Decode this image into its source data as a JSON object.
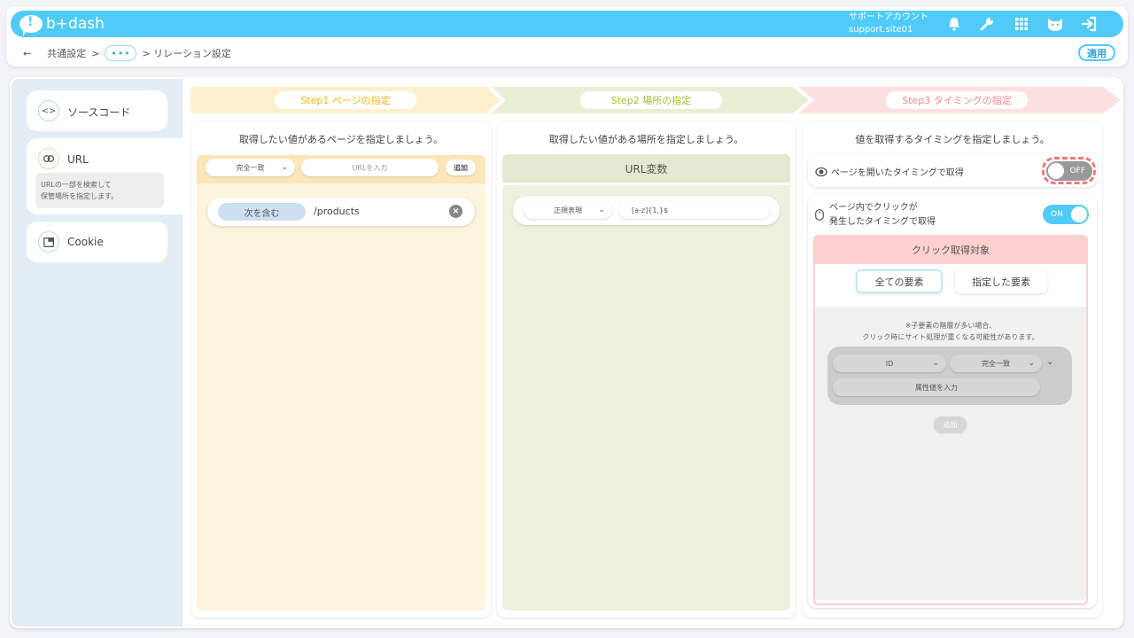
{
  "header": {
    "logo_text": "b+dash",
    "account_line1": "サポートアカウント",
    "account_line2": "support.site01",
    "icons": [
      "bell-icon",
      "wrench-icon",
      "grid-icon",
      "cat-face-icon",
      "logout-icon"
    ]
  },
  "breadcrumb": {
    "back": "←",
    "common": "共通設定",
    "sep": ">",
    "more": "•••",
    "current": "> リレーション設定"
  },
  "apply_label": "適用",
  "sidebar": {
    "items": [
      {
        "label": "ソースコード",
        "icon": "code-icon"
      },
      {
        "label": "URL",
        "icon": "link-icon",
        "desc1": "URLの一部を検索して",
        "desc2": "保管場所を指定します。"
      },
      {
        "label": "Cookie",
        "icon": "window-icon"
      }
    ]
  },
  "steps": [
    {
      "label": "Step1 ページの指定",
      "color": "#f5b70f"
    },
    {
      "label": "Step2 場所の指定",
      "color": "#9dc234"
    },
    {
      "label": "Step3 タイミングの指定",
      "color": "#f28a8a"
    }
  ],
  "step1": {
    "title": "取得したい値があるページを指定しましょう。",
    "match_select": "完全一致",
    "url_placeholder": "URLを入力",
    "add": "追加",
    "rule_type": "次を含む",
    "rule_value": "/products",
    "clear": "×"
  },
  "step2": {
    "title": "取得したい値がある場所を指定しましょう。",
    "section": "URL変数",
    "regex_select": "正規表現",
    "regex_value": "[a-z]{1,}$"
  },
  "step3": {
    "title": "値を取得するタイミングを指定しましょう。",
    "timing1": "ページを開いたタイミングで取得",
    "timing1_state": "OFF",
    "timing2_line1": "ページ内でクリックが",
    "timing2_line2": "発生したタイミングで取得",
    "timing2_state": "ON",
    "click_target": "クリック取得対象",
    "tab_all": "全ての要素",
    "tab_specified": "指定した要素",
    "note1": "※子要素の階層が多い場合、",
    "note2": "クリック時にサイト処理が重くなる可能性があります。",
    "attr_select": "ID",
    "match_select": "完全一致",
    "attr_placeholder": "属性値を入力",
    "add": "追加"
  }
}
